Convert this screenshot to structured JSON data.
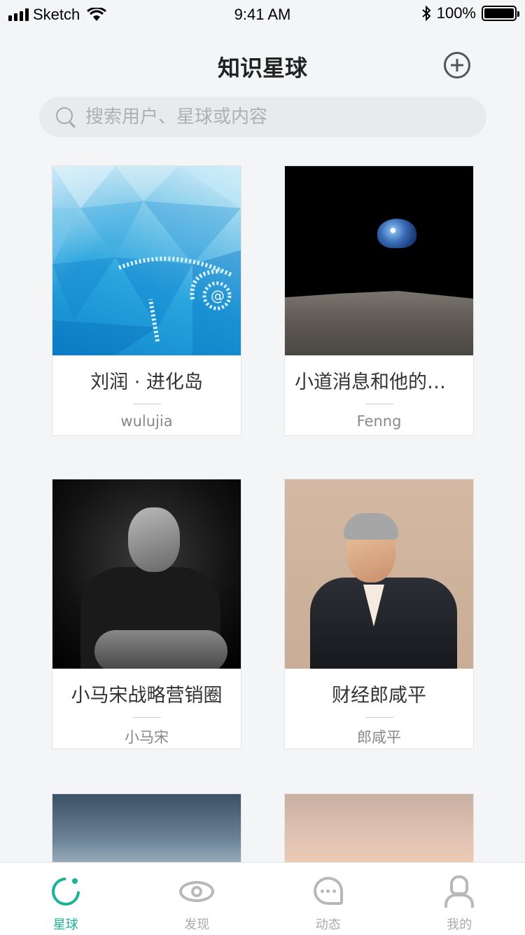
{
  "status_bar": {
    "carrier": "Sketch",
    "time": "9:41 AM",
    "battery": "100%"
  },
  "header": {
    "title": "知识星球"
  },
  "search": {
    "placeholder": "搜索用户、星球或内容"
  },
  "planets": [
    {
      "name": "刘润 · 进化岛",
      "owner": "wulujia"
    },
    {
      "name": "小道消息和他的朋友们",
      "owner": "Fenng"
    },
    {
      "name": "小马宋战略营销圈",
      "owner": "小马宋"
    },
    {
      "name": "财经郎咸平",
      "owner": "郎咸平"
    }
  ],
  "tabbar": {
    "tabs": [
      {
        "label": "星球",
        "icon": "planet-icon",
        "active": true
      },
      {
        "label": "发现",
        "icon": "eye-icon",
        "active": false
      },
      {
        "label": "动态",
        "icon": "chat-icon",
        "active": false
      },
      {
        "label": "我的",
        "icon": "user-icon",
        "active": false
      }
    ]
  },
  "colors": {
    "accent": "#1ab394",
    "background": "#f4f5f7"
  }
}
